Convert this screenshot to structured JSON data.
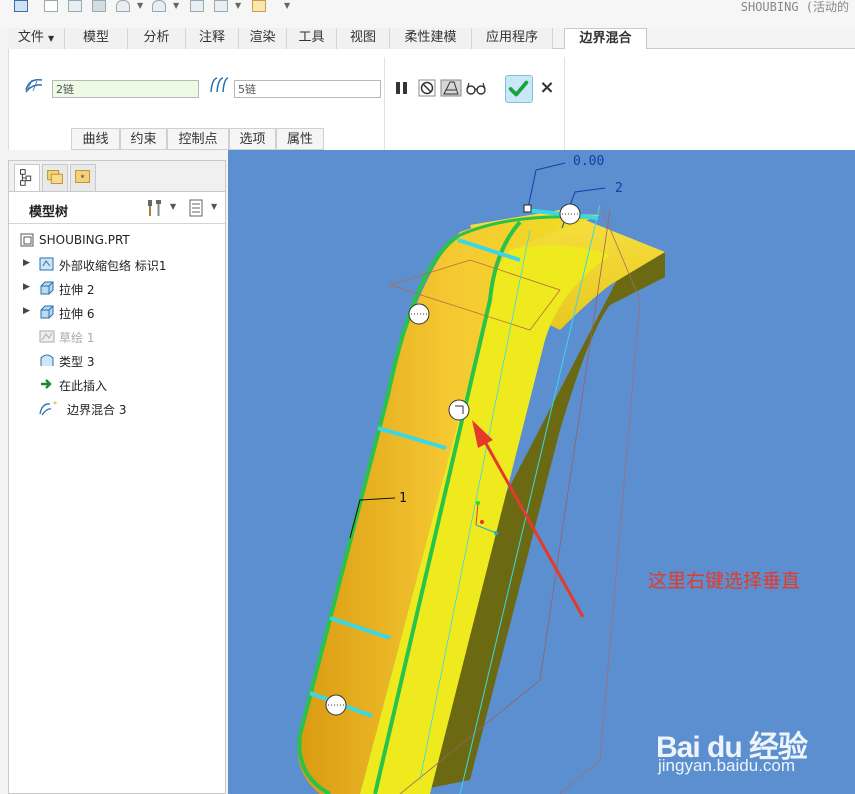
{
  "app": {
    "title": "SHOUBING (活动的"
  },
  "tabs": [
    {
      "label": "文件",
      "has_menu": true
    },
    {
      "label": "模型"
    },
    {
      "label": "分析"
    },
    {
      "label": "注释"
    },
    {
      "label": "渲染"
    },
    {
      "label": "工具"
    },
    {
      "label": "视图"
    },
    {
      "label": "柔性建模"
    },
    {
      "label": "应用程序"
    },
    {
      "label": "边界混合",
      "active": true
    }
  ],
  "ribbon": {
    "first_direction_chain": "2链",
    "second_direction_chain": "5链",
    "subtabs": [
      "曲线",
      "约束",
      "控制点",
      "选项",
      "属性"
    ]
  },
  "panel": {
    "tree_title": "模型树",
    "items": [
      {
        "label": "SHOUBING.PRT",
        "icon": "part-icon",
        "expandable": false
      },
      {
        "label": "外部收缩包络 标识1",
        "icon": "shrinkwrap-icon",
        "expandable": true
      },
      {
        "label": "拉伸 2",
        "icon": "extrude-icon",
        "expandable": true
      },
      {
        "label": "拉伸 6",
        "icon": "extrude-icon",
        "expandable": true
      },
      {
        "label": "草绘 1",
        "icon": "sketch-icon",
        "expandable": false,
        "dimmed": true
      },
      {
        "label": "类型 3",
        "icon": "style-surface-icon",
        "expandable": false
      },
      {
        "label": "在此插入",
        "icon": "insert-arrow-icon",
        "expandable": false
      },
      {
        "label": "边界混合 3",
        "icon": "boundary-blend-icon",
        "expandable": false
      }
    ]
  },
  "viewport": {
    "background": "#5b8fcf",
    "dimension_labels": [
      "0.00",
      "2",
      "1"
    ],
    "annotation": "这里右键选择垂直",
    "annotation_color": "#e53a2a",
    "watermark_logo": "Bai du 经验",
    "watermark_url": "jingyan.baidu.com"
  }
}
